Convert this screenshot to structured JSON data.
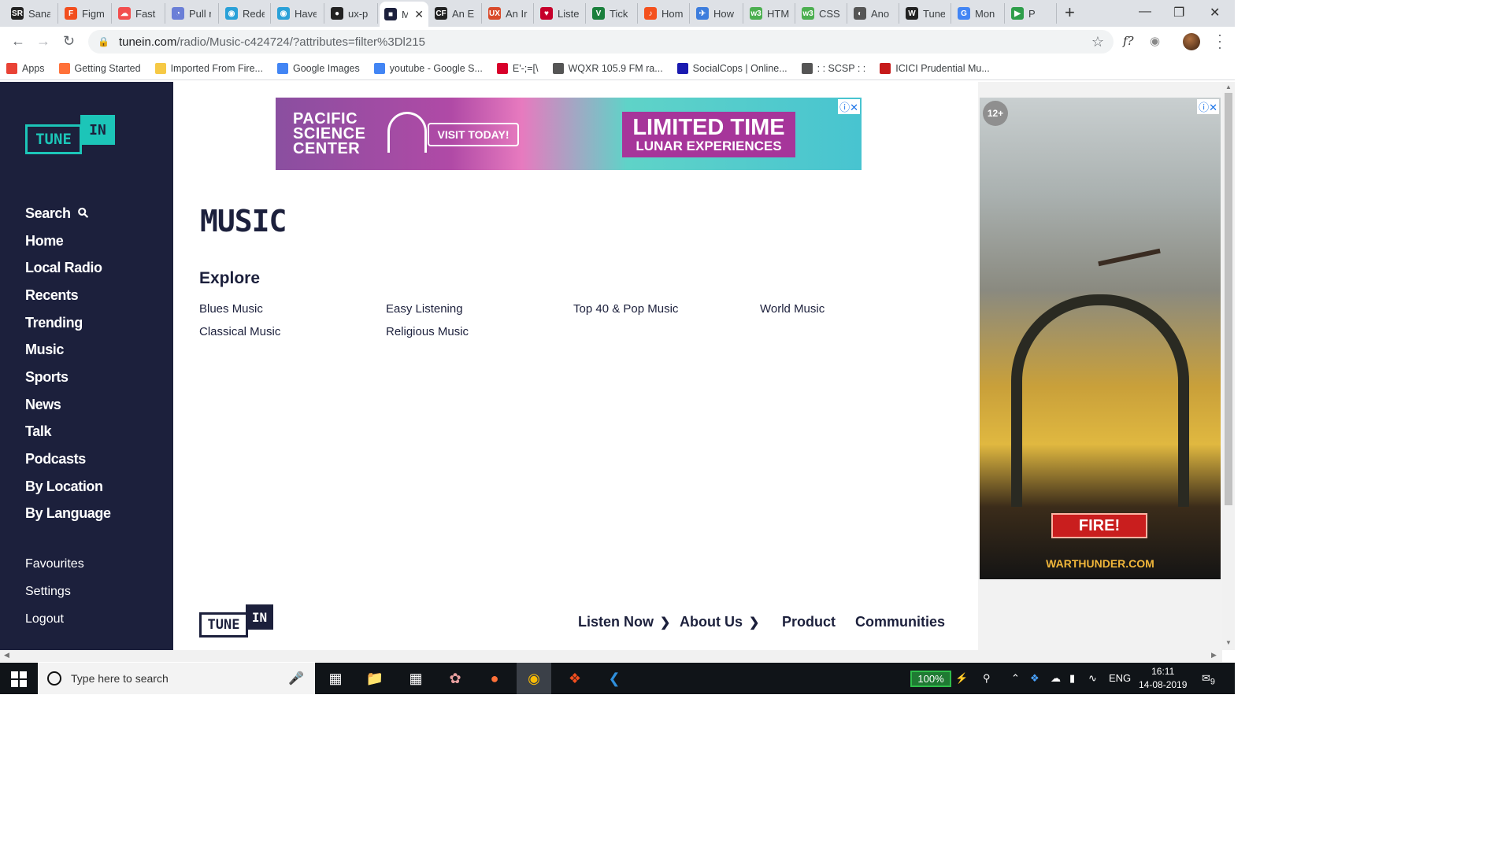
{
  "browser": {
    "tabs": [
      {
        "title": "Sana",
        "icon": "SR",
        "color": "#222"
      },
      {
        "title": "Figma",
        "icon": "F",
        "color": "#f24e1e"
      },
      {
        "title": "Fast",
        "icon": "☁",
        "color": "#f24e4e"
      },
      {
        "title": "Pull r",
        "icon": "◔",
        "color": "#6b7fd7"
      },
      {
        "title": "Rede",
        "icon": "◉",
        "color": "#2aa1d8"
      },
      {
        "title": "Have",
        "icon": "◉",
        "color": "#2aa1d8"
      },
      {
        "title": "ux-p",
        "icon": "●",
        "color": "#222"
      },
      {
        "title": "M",
        "icon": "■",
        "color": "#1c203c",
        "active": true
      },
      {
        "title": "An E",
        "icon": "CF",
        "color": "#222"
      },
      {
        "title": "An Ir",
        "icon": "UX",
        "color": "#d94a2b"
      },
      {
        "title": "Liste",
        "icon": "♥",
        "color": "#c6002b"
      },
      {
        "title": "Tick",
        "icon": "V",
        "color": "#1a7f3c"
      },
      {
        "title": "Hom",
        "icon": "♪",
        "color": "#f4511e"
      },
      {
        "title": "How",
        "icon": "✈",
        "color": "#3d7ddd"
      },
      {
        "title": "HTM",
        "icon": "w3",
        "color": "#4caf50"
      },
      {
        "title": "CSS",
        "icon": "w3",
        "color": "#4caf50"
      },
      {
        "title": "Ano",
        "icon": "◐",
        "color": "#555"
      },
      {
        "title": "Tune",
        "icon": "W",
        "color": "#222"
      },
      {
        "title": "Mon",
        "icon": "G",
        "color": "#4285f4"
      },
      {
        "title": "P",
        "icon": "▶",
        "color": "#2e9e4a"
      }
    ],
    "new_tab": "+",
    "window_controls": [
      "—",
      "❐",
      "✕"
    ],
    "url_host": "tunein.com",
    "url_path": "/radio/Music-c424724/?attributes=filter%3Dl215",
    "toolbar_font_icon": "f?",
    "bookmarks": [
      {
        "label": "Apps",
        "icon": "apps-grid",
        "color": "#e94235"
      },
      {
        "label": "Getting Started",
        "icon": "firefox",
        "color": "#ff7139"
      },
      {
        "label": "Imported From Fire...",
        "icon": "folder",
        "color": "#f6c945"
      },
      {
        "label": "Google Images",
        "icon": "google",
        "color": "#4285f4"
      },
      {
        "label": "youtube - Google S...",
        "icon": "google",
        "color": "#4285f4"
      },
      {
        "label": "E'-;=[\\",
        "icon": "ask",
        "color": "#d8002b"
      },
      {
        "label": "WQXR 105.9 FM ra...",
        "icon": "globe",
        "color": "#555"
      },
      {
        "label": "SocialCops | Online...",
        "icon": "socialcops",
        "color": "#1a1ab0"
      },
      {
        "label": ": : SCSP : :",
        "icon": "globe",
        "color": "#555"
      },
      {
        "label": "ICICI Prudential Mu...",
        "icon": "icici",
        "color": "#c61a1a"
      }
    ]
  },
  "logo": {
    "tune": "TUNE",
    "in": "IN"
  },
  "sidebar": {
    "items": [
      {
        "label": "Search",
        "has_icon": true
      },
      {
        "label": "Home"
      },
      {
        "label": "Local Radio"
      },
      {
        "label": "Recents"
      },
      {
        "label": "Trending"
      },
      {
        "label": "Music"
      },
      {
        "label": "Sports"
      },
      {
        "label": "News"
      },
      {
        "label": "Talk"
      },
      {
        "label": "Podcasts"
      },
      {
        "label": "By Location"
      },
      {
        "label": "By Language"
      }
    ],
    "secondary": [
      {
        "label": "Favourites"
      },
      {
        "label": "Settings"
      },
      {
        "label": "Logout"
      }
    ]
  },
  "ads": {
    "top": {
      "line1": "PACIFIC",
      "line2": "SCIENCE",
      "line3": "CENTER",
      "cta": "VISIT TODAY!",
      "headline": "LIMITED TIME",
      "subline": "LUNAR EXPERIENCES"
    },
    "side": {
      "rating": "12+",
      "cta": "FIRE!",
      "domain": "WARTHUNDER.COM"
    },
    "adchoice": "ⓘ✕"
  },
  "main": {
    "title": "MUSIC",
    "explore_heading": "Explore",
    "explore_links": [
      "Blues Music",
      "Easy Listening",
      "Top 40 & Pop Music",
      "World Music",
      "Classical Music",
      "Religious Music"
    ]
  },
  "footer": {
    "nav": [
      {
        "label": "Listen Now",
        "chevron": true
      },
      {
        "label": "About Us",
        "chevron": true
      },
      {
        "label": "Product",
        "chevron": false
      },
      {
        "label": "Communities",
        "chevron": false
      }
    ]
  },
  "taskbar": {
    "search_placeholder": "Type here to search",
    "battery": "100%",
    "language": "ENG",
    "time": "16:11",
    "date": "14-08-2019",
    "notifications": "9"
  }
}
